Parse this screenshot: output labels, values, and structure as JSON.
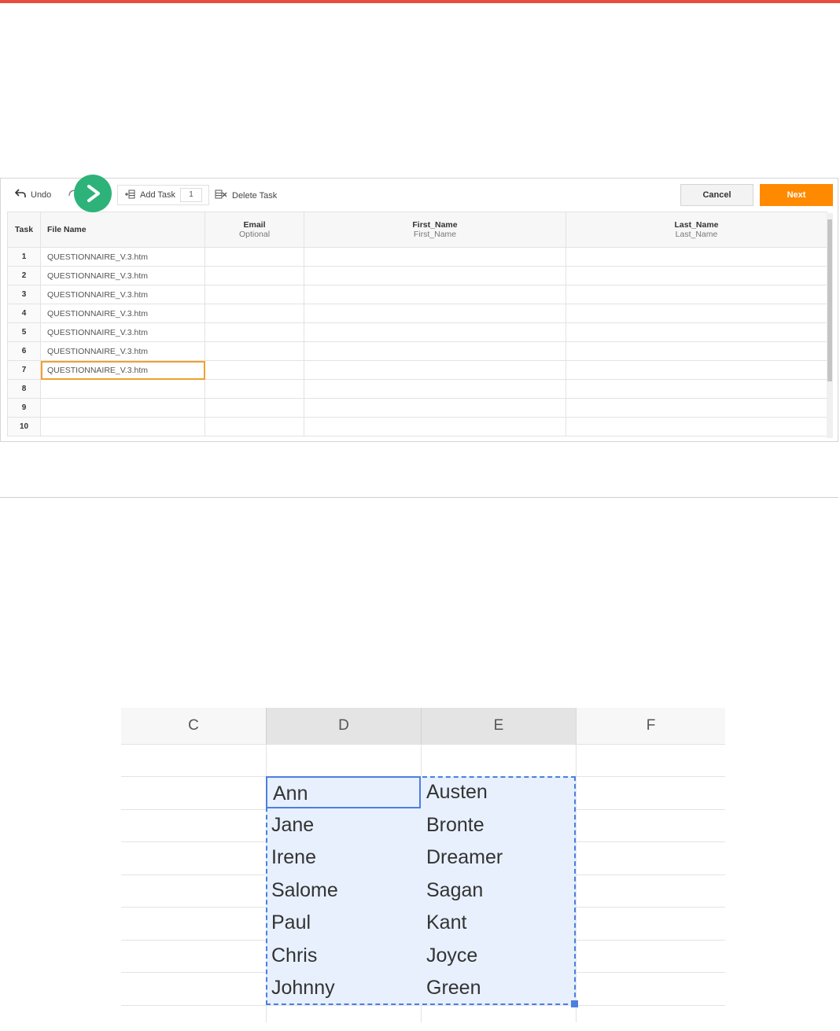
{
  "toolbar": {
    "undo_label": "Undo",
    "add_task_label": "Add Task",
    "add_task_count": "1",
    "delete_task_label": "Delete Task",
    "cancel_label": "Cancel",
    "next_label": "Next"
  },
  "grid": {
    "headers": {
      "task": "Task",
      "file_name": "File Name",
      "email": "Email",
      "email_sub": "Optional",
      "first_name": "First_Name",
      "first_name_sub": "First_Name",
      "last_name": "Last_Name",
      "last_name_sub": "Last_Name"
    },
    "rows": [
      {
        "num": "1",
        "file": "QUESTIONNAIRE_V.3.htm"
      },
      {
        "num": "2",
        "file": "QUESTIONNAIRE_V.3.htm"
      },
      {
        "num": "3",
        "file": "QUESTIONNAIRE_V.3.htm"
      },
      {
        "num": "4",
        "file": "QUESTIONNAIRE_V.3.htm"
      },
      {
        "num": "5",
        "file": "QUESTIONNAIRE_V.3.htm"
      },
      {
        "num": "6",
        "file": "QUESTIONNAIRE_V.3.htm"
      },
      {
        "num": "7",
        "file": "QUESTIONNAIRE_V.3.htm"
      },
      {
        "num": "8",
        "file": ""
      },
      {
        "num": "9",
        "file": ""
      },
      {
        "num": "10",
        "file": ""
      }
    ]
  },
  "sheet": {
    "columns": [
      "C",
      "D",
      "E",
      "F"
    ],
    "names": [
      {
        "first": "Ann",
        "last": "Austen"
      },
      {
        "first": "Jane",
        "last": "Bronte"
      },
      {
        "first": "Irene",
        "last": "Dreamer"
      },
      {
        "first": "Salome",
        "last": "Sagan"
      },
      {
        "first": "Paul",
        "last": "Kant"
      },
      {
        "first": "Chris",
        "last": "Joyce"
      },
      {
        "first": "Johnny",
        "last": "Green"
      }
    ]
  },
  "colors": {
    "accent_bar": "#e84c3d",
    "next_button": "#ff8a00",
    "play_badge": "#2db37a",
    "selection": "#4a7fe0"
  }
}
